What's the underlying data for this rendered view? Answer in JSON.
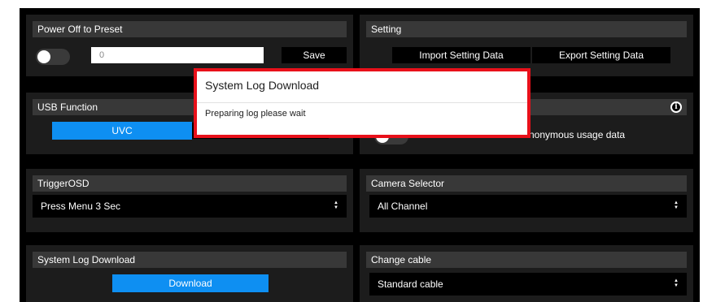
{
  "power_off_preset": {
    "title": "Power Off to Preset",
    "toggle_on": false,
    "value": "0",
    "save_label": "Save"
  },
  "setting": {
    "title": "Setting",
    "import_label": "Import Setting Data",
    "export_label": "Export Setting Data"
  },
  "usb_function": {
    "title": "USB Function",
    "uvc_label": "UVC"
  },
  "usage_data": {
    "label_visible": "nonymous usage data",
    "toggle_on": false
  },
  "trigger_osd": {
    "title": "TriggerOSD",
    "selected": "Press Menu 3 Sec"
  },
  "camera_selector": {
    "title": "Camera Selector",
    "selected": "All Channel"
  },
  "system_log": {
    "title": "System Log Download",
    "download_label": "Download"
  },
  "change_cable": {
    "title": "Change cable",
    "selected": "Standard cable"
  },
  "dialog": {
    "title": "System Log Download",
    "message": "Preparing log please wait"
  },
  "icons": {
    "info": "info-icon",
    "select_arrows": "select-arrows-icon"
  },
  "colors": {
    "accent_blue": "#0e8ff2",
    "dialog_border": "#e8101a",
    "panel_bg": "#1c1c1c",
    "header_bg": "#383838"
  }
}
